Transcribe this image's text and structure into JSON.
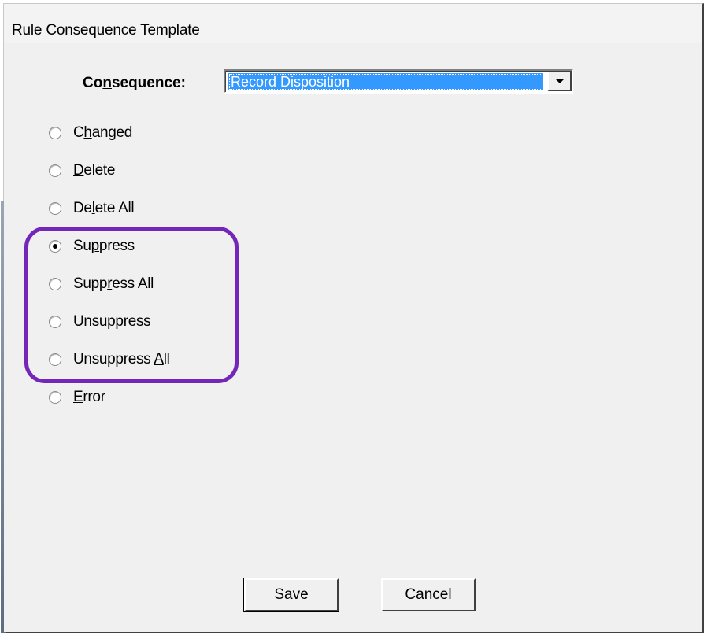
{
  "window": {
    "title": "Rule Consequence Template"
  },
  "consequence": {
    "label_prefix": "Co",
    "label_mnemonic": "n",
    "label_suffix": "sequence:",
    "selected": "Record Disposition"
  },
  "options": [
    {
      "pre": "C",
      "mn": "h",
      "post": "anged",
      "checked": false
    },
    {
      "pre": "",
      "mn": "D",
      "post": "elete",
      "checked": false
    },
    {
      "pre": "De",
      "mn": "l",
      "post": "ete All",
      "checked": false
    },
    {
      "pre": "Su",
      "mn": "p",
      "post": "press",
      "checked": true
    },
    {
      "pre": "Supp",
      "mn": "r",
      "post": "ess All",
      "checked": false
    },
    {
      "pre": "",
      "mn": "U",
      "post": "nsuppress",
      "checked": false
    },
    {
      "pre": "Unsuppress ",
      "mn": "A",
      "post": "ll",
      "checked": false
    },
    {
      "pre": "",
      "mn": "E",
      "post": "rror",
      "checked": false
    }
  ],
  "buttons": {
    "save": {
      "mn": "S",
      "post": "ave"
    },
    "cancel": {
      "mn": "C",
      "post": "ancel"
    }
  },
  "colors": {
    "highlight": "#7326b8",
    "selection": "#3399ff"
  }
}
